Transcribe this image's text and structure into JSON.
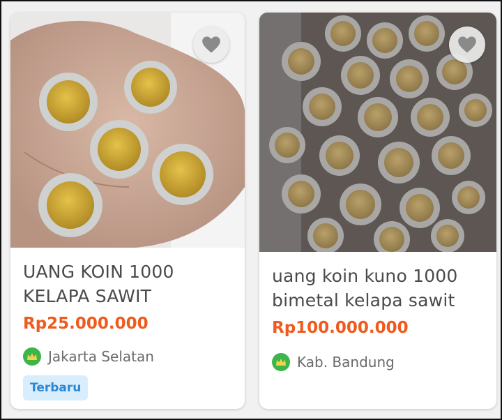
{
  "listings": [
    {
      "title_line1": "UANG KOIN 1000",
      "title_line2": "KELAPA SAWIT",
      "price": "Rp25.000.000",
      "location": "Jakarta Selatan",
      "tag": "Terbaru",
      "favorite_icon": "heart-icon",
      "seller_badge_icon": "crown-badge-icon"
    },
    {
      "title_line1": "uang koin kuno 1000",
      "title_line2": "bimetal kelapa sawit",
      "price": "Rp100.000.000",
      "location": "Kab. Bandung",
      "favorite_icon": "heart-icon",
      "seller_badge_icon": "crown-badge-icon"
    }
  ],
  "colors": {
    "price": "#ef5b1c",
    "tag_bg": "#d8eefc",
    "tag_text": "#2c86d6",
    "badge": "#3cb54a"
  }
}
